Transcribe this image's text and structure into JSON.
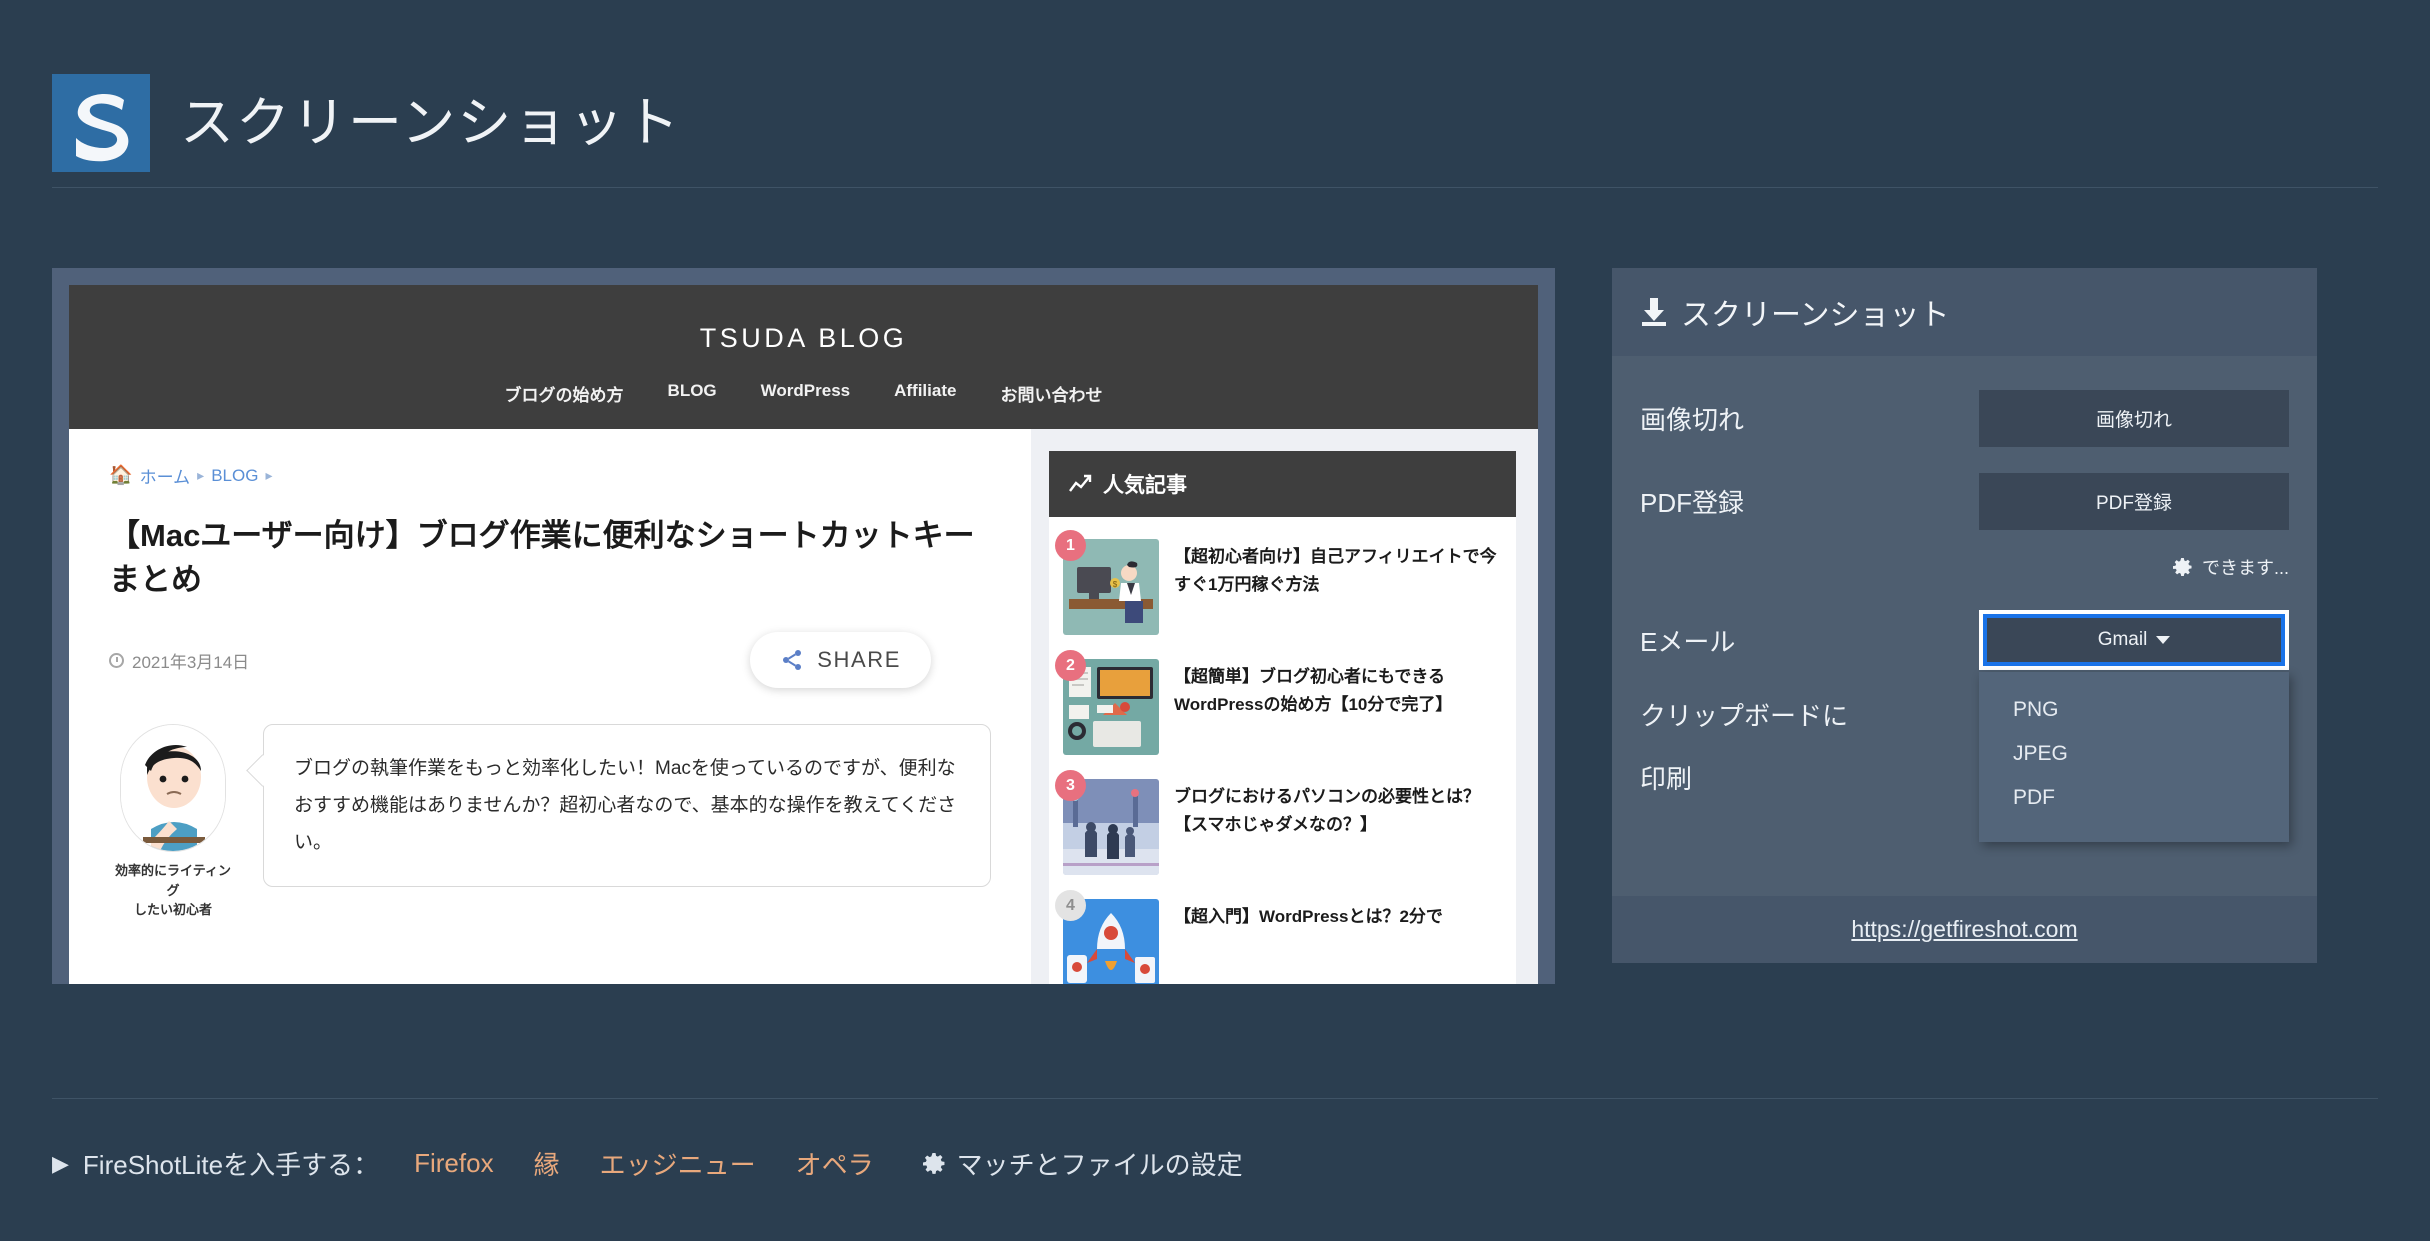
{
  "app": {
    "title": "スクリーンショット",
    "logo_icon": "fireshot-s-logo"
  },
  "preview": {
    "blog": {
      "brand": "TSUDA BLOG",
      "nav": [
        "ブログの始め方",
        "BLOG",
        "WordPress",
        "Affiliate",
        "お問い合わせ"
      ],
      "breadcrumb": [
        "ホーム",
        "BLOG"
      ],
      "article_title": "【Macユーザー向け】ブログ作業に便利なショートカットキーまとめ",
      "post_date": "2021年3月14日",
      "share_label": "SHARE",
      "avatar_caption": "効率的にライティング\nしたい初心者",
      "quote": "ブログの執筆作業をもっと効率化したい！Macを使っているのですが、便利なおすすめ機能はありませんか？超初心者なので、基本的な操作を教えてください。",
      "popular_heading": "人気記事",
      "popular_items": [
        {
          "rank": "1",
          "title": "【超初心者向け】自己アフィリエイトで今すぐ1万円稼ぐ方法"
        },
        {
          "rank": "2",
          "title": "【超簡単】ブログ初心者にもできるWordPressの始め方【10分で完了】"
        },
        {
          "rank": "3",
          "title": "ブログにおけるパソコンの必要性とは？【スマホじゃダメなの？】"
        },
        {
          "rank": "4",
          "title": "【超入門】WordPressとは？2分で"
        }
      ]
    }
  },
  "card": {
    "heading": "スクリーンショット",
    "heading_icon": "download-icon",
    "rows": [
      {
        "label": "画像切れ",
        "button": "画像切れ"
      },
      {
        "label": "PDF登録",
        "button": "PDF登録"
      }
    ],
    "gear_link": "できます...",
    "gear_icon": "gear-icon",
    "email": {
      "label": "Eメール",
      "selected": "Gmail",
      "options": [
        "PNG",
        "JPEG",
        "PDF"
      ]
    },
    "clipboard_label": "クリップボードに",
    "print_label": "印刷",
    "footer_url": "https://getfireshot.com"
  },
  "footer": {
    "triangle_icon": "play-triangle-icon",
    "label": "FireShotLiteを入手する：",
    "browsers": [
      "Firefox",
      "縁",
      "エッジニュー",
      "オペラ"
    ],
    "settings_icon": "gear-icon",
    "settings_label": "マッチとファイルの設定"
  },
  "colors": {
    "page_bg": "#2b3e50",
    "card_bg": "#4e5e70",
    "card_band": "#46566a",
    "button_bg": "#3a4757",
    "focus_ring": "#1a73e8",
    "accent_link": "#e8a87c",
    "rank_badge": "#e8707f"
  }
}
